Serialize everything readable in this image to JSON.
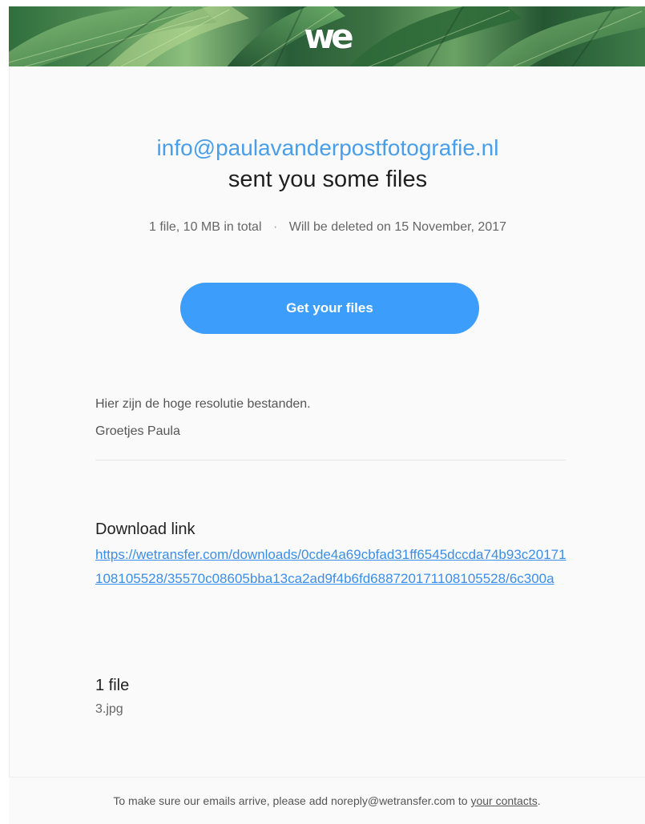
{
  "header": {
    "brand": "we"
  },
  "transfer": {
    "sender": "info@paulavanderpostfotografie.nl",
    "headline": "sent you some files",
    "summary": "1 file, 10 MB in total",
    "separator": "·",
    "expiry": "Will be deleted on 15 November, 2017",
    "button": "Get your files"
  },
  "message": {
    "lines": [
      "Hier zijn de hoge resolutie bestanden.",
      "Groetjes Paula"
    ]
  },
  "download": {
    "title": "Download link",
    "url": "https://wetransfer.com/downloads/0cde4a69cbfad31ff6545dccda74b93c20171108105528/35570c08605bba13ca2ad9f4b6fd688720171108105528/6c300a"
  },
  "files": {
    "title": "1 file",
    "items": [
      "3.jpg"
    ]
  },
  "footer": {
    "prefix": "To make sure our emails arrive, please add noreply@wetransfer.com to ",
    "link": "your contacts",
    "suffix": "."
  },
  "colors": {
    "accent": "#3d9dfa",
    "link": "#3b8ee8",
    "sender": "#4a9ee8"
  }
}
